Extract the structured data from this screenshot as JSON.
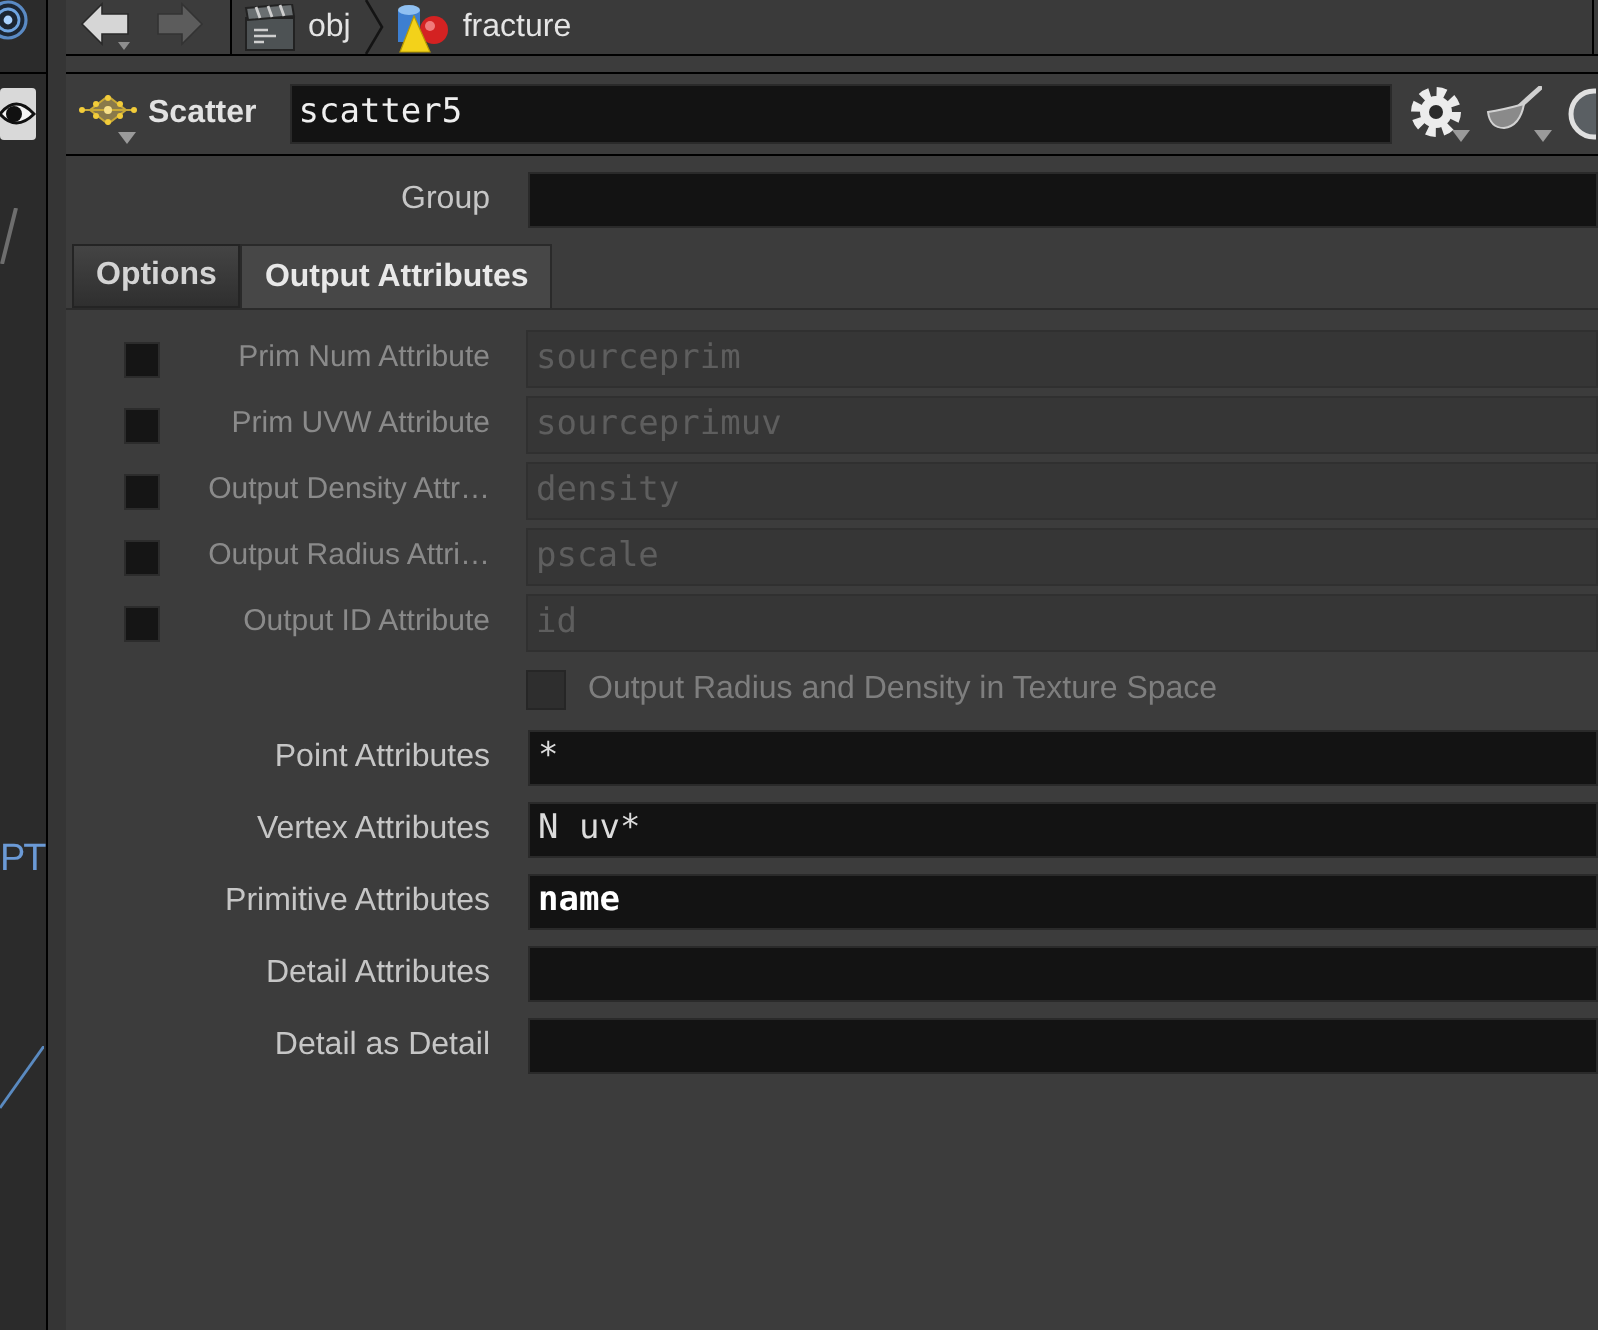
{
  "viewport": {
    "label": "PT"
  },
  "navigation": {
    "back_enabled": true,
    "forward_enabled": false
  },
  "path": [
    {
      "label": "obj",
      "kind": "network"
    },
    {
      "label": "fracture",
      "kind": "geometry"
    }
  ],
  "node": {
    "type": "Scatter",
    "name": "scatter5"
  },
  "group": {
    "label": "Group"
  },
  "tabs": [
    {
      "label": "Options",
      "selected": false
    },
    {
      "label": "Output Attributes",
      "selected": true
    }
  ],
  "optional_attributes": [
    {
      "label": "Prim Num Attribute",
      "checked": false,
      "value": "sourceprim"
    },
    {
      "label": "Prim UVW Attribute",
      "checked": false,
      "value": "sourceprimuv"
    },
    {
      "label": "Output Density Attr…",
      "checked": false,
      "value": "density"
    },
    {
      "label": "Output Radius Attri…",
      "checked": false,
      "value": "pscale"
    },
    {
      "label": "Output ID Attribute",
      "checked": false,
      "value": "id"
    }
  ],
  "texture_space_toggle": {
    "label": "Output Radius and Density in Texture Space",
    "checked": false,
    "disabled": true
  },
  "attributes": [
    {
      "label": "Point Attributes",
      "value": "*",
      "bold": false
    },
    {
      "label": "Vertex Attributes",
      "value": "N uv*",
      "bold": false
    },
    {
      "label": "Primitive Attributes",
      "value": "name",
      "bold": true
    },
    {
      "label": "Detail Attributes"
    },
    {
      "label": "Detail as Detail"
    }
  ]
}
